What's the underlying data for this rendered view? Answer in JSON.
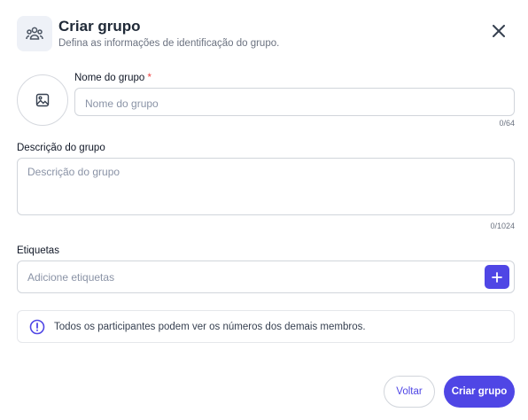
{
  "header": {
    "icon": "group-icon",
    "title": "Criar grupo",
    "subtitle": "Defina as informações de identificação do grupo."
  },
  "close_icon": "close-icon",
  "avatar": {
    "icon": "image-icon"
  },
  "name_field": {
    "label": "Nome do grupo",
    "required_mark": "*",
    "placeholder": "Nome do grupo",
    "value": "",
    "counter": "0/64"
  },
  "description_field": {
    "label": "Descrição do grupo",
    "placeholder": "Descrição do grupo",
    "value": "",
    "counter": "0/1024"
  },
  "tags_field": {
    "label": "Etiquetas",
    "placeholder": "Adicione etiquetas",
    "value": "",
    "add_icon": "plus-icon"
  },
  "info": {
    "icon": "info-icon",
    "text": "Todos os participantes podem ver os números dos demais membros."
  },
  "footer": {
    "back_label": "Voltar",
    "create_label": "Criar grupo"
  },
  "colors": {
    "accent": "#4f46e5",
    "required": "#ef4444",
    "info_icon": "#4f46e5"
  }
}
